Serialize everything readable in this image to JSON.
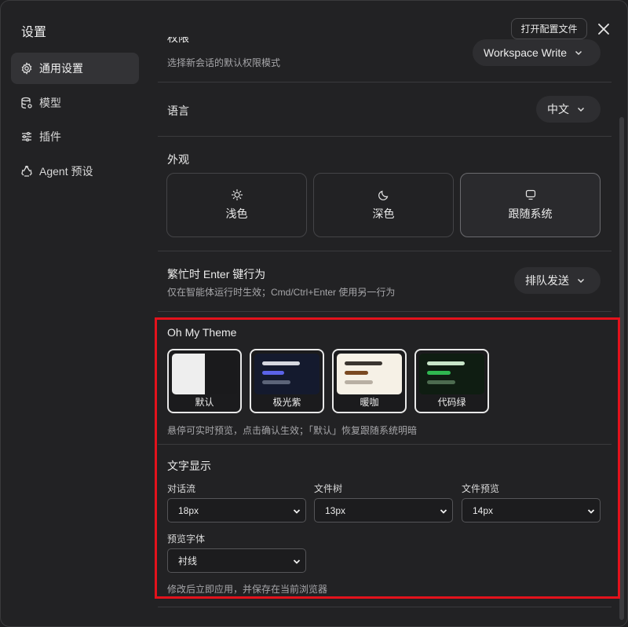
{
  "sidebar": {
    "title": "设置",
    "items": [
      {
        "label": "通用设置",
        "icon": "gear-icon",
        "active": true
      },
      {
        "label": "模型",
        "icon": "database-icon",
        "active": false
      },
      {
        "label": "插件",
        "icon": "sliders-icon",
        "active": false
      },
      {
        "label": "Agent 预设",
        "icon": "recycle-icon",
        "active": false
      }
    ]
  },
  "header": {
    "open_config_label": "打开配置文件",
    "close_icon": "close-icon"
  },
  "permission": {
    "label": "权限",
    "description": "选择新会话的默认权限模式",
    "value": "Workspace Write"
  },
  "language": {
    "label": "语言",
    "value": "中文"
  },
  "appearance": {
    "label": "外观",
    "options": [
      {
        "label": "浅色",
        "icon": "sun-icon",
        "selected": false
      },
      {
        "label": "深色",
        "icon": "moon-icon",
        "selected": false
      },
      {
        "label": "跟随系统",
        "icon": "monitor-icon",
        "selected": true
      }
    ]
  },
  "busy_enter": {
    "label": "繁忙时 Enter 键行为",
    "description": "仅在智能体运行时生效；Cmd/Ctrl+Enter 使用另一行为",
    "value": "排队发送"
  },
  "theme": {
    "label": "Oh My Theme",
    "options": [
      {
        "label": "默认"
      },
      {
        "label": "极光紫"
      },
      {
        "label": "暖咖"
      },
      {
        "label": "代码绿"
      }
    ],
    "hint": "悬停可实时预览，点击确认生效；「默认」恢复跟随系统明暗",
    "colors": {
      "aurora_bg": "#141a2e",
      "aurora_bar1": "#d6d8e0",
      "aurora_bar2": "#5b63e8",
      "aurora_bar3": "#5c6478",
      "warm_bg": "#f6f1e6",
      "warm_bar1": "#3a3530",
      "warm_bar2": "#7a4a22",
      "warm_bar3": "#b8afa3",
      "code_bg": "#0f1d12",
      "code_bar1": "#c8e6c9",
      "code_bar2": "#2fb850",
      "code_bar3": "#4d6b50"
    }
  },
  "text_display": {
    "label": "文字显示",
    "fields": [
      {
        "label": "对话流",
        "value": "18px"
      },
      {
        "label": "文件树",
        "value": "13px"
      },
      {
        "label": "文件预览",
        "value": "14px"
      }
    ],
    "font_field": {
      "label": "预览字体",
      "value": "衬线"
    },
    "hint": "修改后立即应用，并保存在当前浏览器"
  },
  "colors": {
    "highlight": "#e3121c",
    "background": "#222224"
  }
}
